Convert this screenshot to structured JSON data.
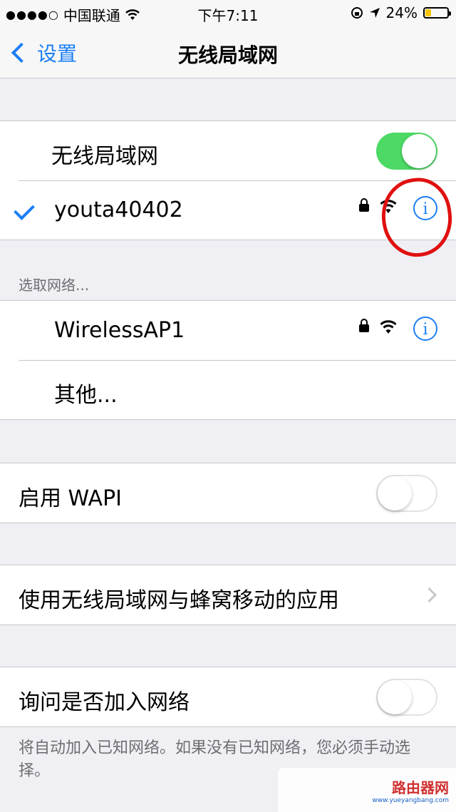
{
  "status_bar": {
    "carrier": "中国联通",
    "time": "下午7:11",
    "battery": "24%"
  },
  "nav": {
    "back_label": "设置",
    "title": "无线局域网"
  },
  "wifi_group": {
    "toggle_label": "无线局域网",
    "toggle_on": true,
    "connected_network": "youta40402",
    "info_glyph": "i"
  },
  "networks_section": {
    "header": "选取网络...",
    "networks": [
      {
        "name": "WirelessAP1",
        "secured": true,
        "info_glyph": "i"
      }
    ],
    "other_label": "其他..."
  },
  "wapi": {
    "label": "启用 WAPI",
    "toggle_on": false
  },
  "apps": {
    "label": "使用无线局域网与蜂窝移动的应用"
  },
  "ask_join": {
    "label": "询问是否加入网络",
    "toggle_on": false,
    "footer": "将自动加入已知网络。如果没有已知网络，您必须手动选择。"
  },
  "watermark": {
    "title": "路由器网",
    "url": "www.yueyangbang.com"
  },
  "colors": {
    "accent": "#1b7ff5",
    "toggle_on": "#4cd964",
    "annotation": "#e01010",
    "background": "#efeff4"
  },
  "icons": [
    "signal-dots-icon",
    "wifi-icon",
    "lock-icon",
    "location-icon",
    "battery-icon",
    "checkmark-icon",
    "info-icon",
    "chevron-right-icon"
  ]
}
